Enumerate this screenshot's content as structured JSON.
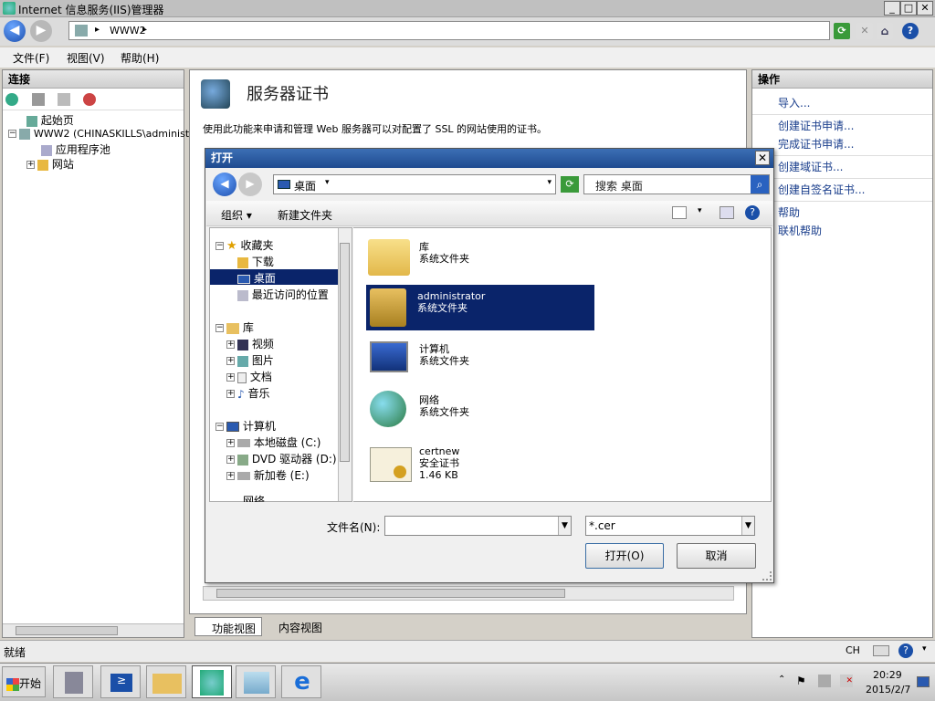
{
  "window": {
    "title": "Internet 信息服务(IIS)管理器"
  },
  "address": {
    "path1": "WWW2",
    "sep": "▸"
  },
  "menu": {
    "file": "文件(F)",
    "view": "视图(V)",
    "help": "帮助(H)"
  },
  "left_panel": {
    "title": "连接",
    "tree": [
      "起始页",
      "WWW2 (CHINASKILLS\\administ",
      "应用程序池",
      "网站"
    ]
  },
  "center": {
    "heading": "服务器证书",
    "description": "使用此功能来申请和管理 Web 服务器可以对配置了 SSL 的网站使用的证书。",
    "tab_features": "功能视图",
    "tab_content": "内容视图"
  },
  "right_panel": {
    "title": "操作",
    "actions": [
      "导入...",
      "创建证书申请...",
      "完成证书申请...",
      "创建域证书...",
      "创建自签名证书...",
      "帮助",
      "联机帮助"
    ]
  },
  "dialog": {
    "title": "打开",
    "location": "桌面",
    "search_placeholder": "搜索 桌面",
    "organize": "组织 ▾",
    "new_folder": "新建文件夹",
    "nav": {
      "favorites": "收藏夹",
      "downloads": "下载",
      "desktop": "桌面",
      "recent": "最近访问的位置",
      "libraries": "库",
      "videos": "视频",
      "pictures": "图片",
      "documents": "文档",
      "music": "音乐",
      "computer": "计算机",
      "disk_c": "本地磁盘 (C:)",
      "dvd": "DVD 驱动器 (D:)",
      "disk_e": "新加卷 (E:)",
      "network": "网络"
    },
    "files": [
      {
        "name": "库",
        "type": "系统文件夹"
      },
      {
        "name": "administrator",
        "type": "系统文件夹"
      },
      {
        "name": "计算机",
        "type": "系统文件夹"
      },
      {
        "name": "网络",
        "type": "系统文件夹"
      },
      {
        "name": "certnew",
        "type": "安全证书",
        "size": "1.46 KB"
      }
    ],
    "filename_label": "文件名(N):",
    "filename_value": "",
    "filter": "*.cer",
    "open_button": "打开(O)",
    "cancel_button": "取消"
  },
  "statusbar": {
    "text": "就绪"
  },
  "taskbar": {
    "start": "开始",
    "lang": "CH",
    "time": "20:29",
    "date": "2015/2/7"
  },
  "colors": {
    "selection": "#0a246a",
    "link": "#1a3e8c",
    "titlebar_active": "#1e4a8f"
  }
}
